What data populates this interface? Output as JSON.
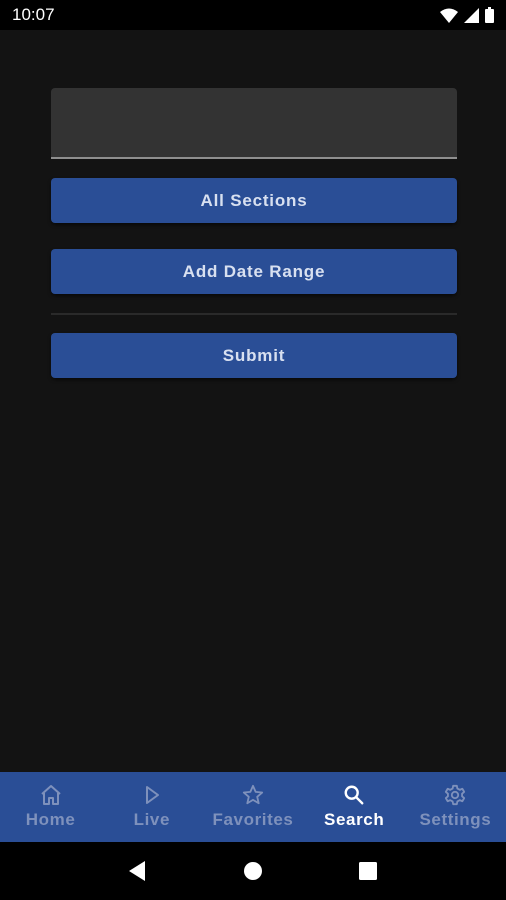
{
  "status_bar": {
    "time": "10:07",
    "icons": [
      "wifi-icon",
      "cellular-signal-icon",
      "battery-icon"
    ]
  },
  "search": {
    "value": "",
    "placeholder": ""
  },
  "buttons": {
    "sections_label": "All Sections",
    "date_range_label": "Add Date Range",
    "submit_label": "Submit"
  },
  "bottom_nav": {
    "items": [
      {
        "label": "Home",
        "icon": "home-icon",
        "active": false
      },
      {
        "label": "Live",
        "icon": "play-icon",
        "active": false
      },
      {
        "label": "Favorites",
        "icon": "star-icon",
        "active": false
      },
      {
        "label": "Search",
        "icon": "search-icon",
        "active": true
      },
      {
        "label": "Settings",
        "icon": "gear-icon",
        "active": false
      }
    ]
  },
  "system_nav": {
    "buttons": [
      "back-icon",
      "home-circle-icon",
      "recents-icon"
    ]
  },
  "colors": {
    "background": "#131313",
    "accent": "#2a4e96",
    "field": "#333333",
    "nav_inactive": "#7e91bc",
    "nav_active": "#ffffff"
  }
}
